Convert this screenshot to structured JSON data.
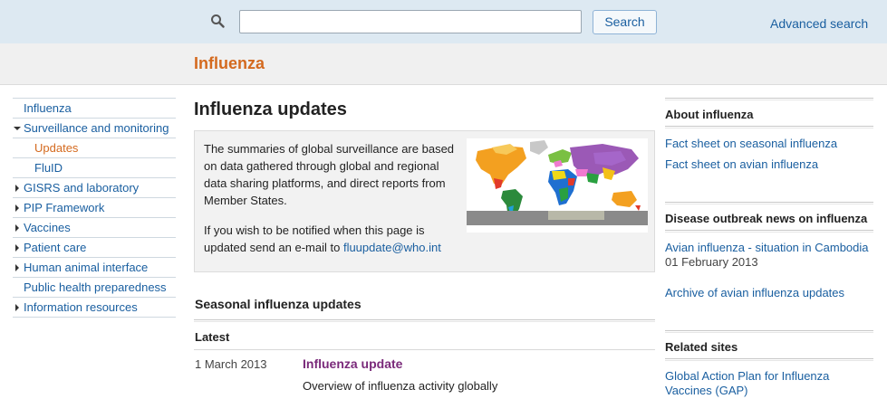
{
  "search": {
    "placeholder": "",
    "value": "",
    "button_label": "Search",
    "advanced_label": "Advanced search"
  },
  "section": {
    "title": "Influenza"
  },
  "leftnav": {
    "items": [
      {
        "label": "Influenza",
        "expander": "none",
        "level": 0,
        "active": false
      },
      {
        "label": "Surveillance and monitoring",
        "expander": "open",
        "level": 0,
        "active": false
      },
      {
        "label": "Updates",
        "expander": "none",
        "level": 1,
        "active": true
      },
      {
        "label": "FluID",
        "expander": "none",
        "level": 1,
        "active": false
      },
      {
        "label": "GISRS and laboratory",
        "expander": "closed",
        "level": 0,
        "active": false
      },
      {
        "label": "PIP Framework",
        "expander": "closed",
        "level": 0,
        "active": false
      },
      {
        "label": "Vaccines",
        "expander": "closed",
        "level": 0,
        "active": false
      },
      {
        "label": "Patient care",
        "expander": "closed",
        "level": 0,
        "active": false
      },
      {
        "label": "Human animal interface",
        "expander": "closed",
        "level": 0,
        "active": false
      },
      {
        "label": "Public health preparedness",
        "expander": "none",
        "level": 0,
        "active": false
      },
      {
        "label": "Information resources",
        "expander": "closed",
        "level": 0,
        "active": false
      }
    ]
  },
  "main": {
    "title": "Influenza updates",
    "intro": "The summaries of global surveillance are based on data gathered through global and regional data sharing platforms, and direct reports from Member States.",
    "notify_text": "If you wish to be notified when this page is updated send an e-mail to",
    "notify_email": "fluupdate@who.int",
    "seasonal_title": "Seasonal influenza updates",
    "latest_label": "Latest",
    "update": {
      "date": "1 March 2013",
      "title": "Influenza update",
      "description": "Overview of influenza activity globally"
    }
  },
  "sidebar_right": {
    "about_title": "About influenza",
    "about_links": [
      "Fact sheet on seasonal influenza",
      "Fact sheet on avian influenza"
    ],
    "news_title": "Disease outbreak news on influenza",
    "news_link": "Avian influenza - situation in Cambodia",
    "news_date": "01 February 2013",
    "archive_link": "Archive of avian influenza updates",
    "related_title": "Related sites",
    "related_link": "Global Action Plan for Influenza Vaccines (GAP)"
  },
  "colors": {
    "topbar_bg": "#dde9f2",
    "section_title": "#d46a1f",
    "link": "#1a5fa0",
    "update_title": "#7a2a7a"
  },
  "icons": {
    "search": "magnifier-icon",
    "expand_closed": "triangle-right-icon",
    "expand_open": "triangle-down-icon"
  }
}
